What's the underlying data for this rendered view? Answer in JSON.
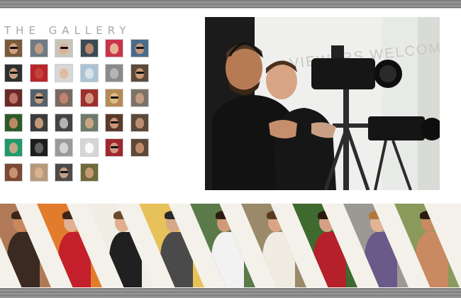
{
  "gallery": {
    "title": "THE GALLERY",
    "thumbnails": [
      {
        "bg": "#7a5a3c",
        "face": "#d8a889",
        "shades": true
      },
      {
        "bg": "#6e7b86",
        "face": "#caa084",
        "shades": false
      },
      {
        "bg": "#c9c4b8",
        "face": "#d9b08e",
        "shades": true
      },
      {
        "bg": "#3c4a55",
        "face": "#c48f6e",
        "shades": false
      },
      {
        "bg": "#c8354a",
        "face": "#e7c2a0",
        "shades": false
      },
      {
        "bg": "#4a6b8c",
        "face": "#d1a07c",
        "shades": true
      },
      {
        "bg": "#2f2f2f",
        "face": "#d8aa8c",
        "shades": true
      },
      {
        "bg": "#b8262b",
        "face": "#c7463e",
        "shades": false
      },
      {
        "bg": "#d7d7d7",
        "face": "#e1b899",
        "shades": false
      },
      {
        "bg": "#a9c4d6",
        "face": "#dfe6ea",
        "shades": false
      },
      {
        "bg": "#8a8a8a",
        "face": "#b9b9b9",
        "shades": false
      },
      {
        "bg": "#5c4a3a",
        "face": "#d7a27f",
        "shades": true
      },
      {
        "bg": "#6b2a2a",
        "face": "#c77b6b",
        "shades": false
      },
      {
        "bg": "#55616b",
        "face": "#d3a584",
        "shades": true
      },
      {
        "bg": "#7a6a62",
        "face": "#c58a72",
        "shades": false
      },
      {
        "bg": "#9e2f2f",
        "face": "#d7a38c",
        "shades": false
      },
      {
        "bg": "#b48a55",
        "face": "#e2c089",
        "shades": true
      },
      {
        "bg": "#7d7268",
        "face": "#c9a184",
        "shades": false
      },
      {
        "bg": "#2d5a2a",
        "face": "#c98d6c",
        "shades": false
      },
      {
        "bg": "#3c3c3c",
        "face": "#d0a282",
        "shades": false
      },
      {
        "bg": "#444444",
        "face": "#bfbfbf",
        "shades": false
      },
      {
        "bg": "#6d7b6a",
        "face": "#d5a98a",
        "shades": false
      },
      {
        "bg": "#5a3a2a",
        "face": "#d8a183",
        "shades": true
      },
      {
        "bg": "#5a4a3c",
        "face": "#c79675",
        "shades": false
      },
      {
        "bg": "#1f9a6a",
        "face": "#d3a78c",
        "shades": false
      },
      {
        "bg": "#1d1d1d",
        "face": "#6a6a6a",
        "shades": false
      },
      {
        "bg": "#9a9a9a",
        "face": "#d9d9d9",
        "shades": false
      },
      {
        "bg": "#d6d6d6",
        "face": "#ffffff",
        "shades": false
      },
      {
        "bg": "#a0272d",
        "face": "#d7a38a",
        "shades": true
      },
      {
        "bg": "#5e4838",
        "face": "#c8926f",
        "shades": false
      },
      {
        "bg": "#7b4a34",
        "face": "#cf9a7a",
        "shades": false
      },
      {
        "bg": "#b79a7c",
        "face": "#dcb492",
        "shades": false
      },
      {
        "bg": "#4c4c4c",
        "face": "#d4a888",
        "shades": true
      },
      {
        "bg": "#6e6a3a",
        "face": "#cf9e7e",
        "shades": false
      }
    ]
  },
  "film_strip": {
    "panels": [
      {
        "bg": "#b07a58",
        "shirt": "#3a2a22",
        "skin": "#c9875e",
        "hair": "#3a2618"
      },
      {
        "bg": "#e27b2c",
        "shirt": "#c4202b",
        "skin": "#e2b095",
        "hair": "#3b241a"
      },
      {
        "bg": "#f0ede4",
        "shirt": "#202020",
        "skin": "#e0ae8e",
        "hair": "#6a4a2c"
      },
      {
        "bg": "#e7c25a",
        "shirt": "#4a4a4a",
        "skin": "#d6a888",
        "hair": "#2a2a2a"
      },
      {
        "bg": "#5a7a4a",
        "shirt": "#f2f2f2",
        "skin": "#cf9a78",
        "hair": "#2b1b12"
      },
      {
        "bg": "#9a8a6a",
        "shirt": "#f0ece2",
        "skin": "#d9a585",
        "hair": "#5a3b22"
      },
      {
        "bg": "#3e6a2f",
        "shirt": "#b5202a",
        "skin": "#d4a184",
        "hair": "#2a1a10"
      },
      {
        "bg": "#9a9a92",
        "shirt": "#6a5a8a",
        "skin": "#e2b494",
        "hair": "#b07a3c"
      },
      {
        "bg": "#8a9a5a",
        "shirt": "#c98a62",
        "skin": "#c98a62",
        "hair": "#2a1a12"
      }
    ]
  },
  "feature_photo": {
    "window_text": "VIEWERS WELCOME"
  }
}
